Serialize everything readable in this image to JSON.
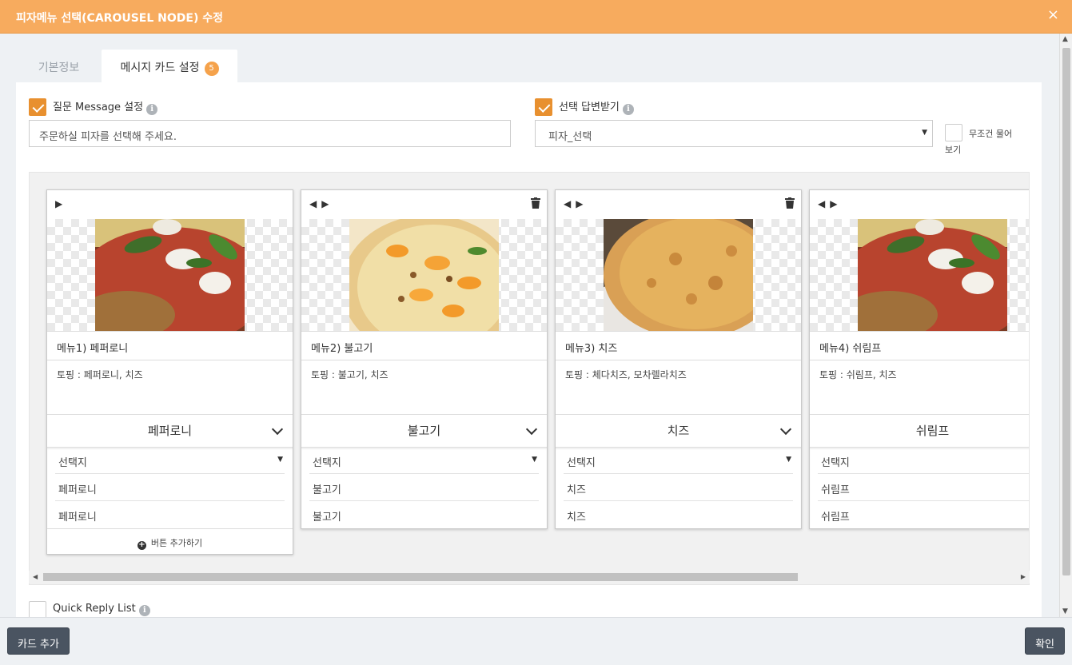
{
  "window": {
    "title": "피자메뉴 선택(CAROUSEL NODE) 수정",
    "close": "×"
  },
  "tabs": [
    {
      "label": "기본정보"
    },
    {
      "label": "메시지 카드 설정",
      "badge": "5"
    }
  ],
  "question": {
    "label": "질문 Message 설정",
    "checked": true,
    "value": "주문하실 피자를 선택해 주세요."
  },
  "answer": {
    "label": "선택 답변받기",
    "checked": true,
    "value": "피자_선택",
    "always_label": "무조건 물어보기"
  },
  "cards": [
    {
      "title": "메뉴1) 페퍼로니",
      "desc": "토핑 : 페퍼로니, 치즈",
      "button": "페퍼로니",
      "opt_select": "선택지",
      "opt1": "페퍼로니",
      "opt2": "페퍼로니"
    },
    {
      "title": "메뉴2) 불고기",
      "desc": "토핑 : 불고기, 치즈",
      "button": "불고기",
      "opt_select": "선택지",
      "opt1": "불고기",
      "opt2": "불고기"
    },
    {
      "title": "메뉴3) 치즈",
      "desc": "토핑 : 체다치즈, 모차렐라치즈",
      "button": "치즈",
      "opt_select": "선택지",
      "opt1": "치즈",
      "opt2": "치즈"
    },
    {
      "title": "메뉴4) 쉬림프",
      "desc": "토핑 : 쉬림프, 치즈",
      "button": "쉬림프",
      "opt_select": "선택지",
      "opt1": "쉬림프",
      "opt2": "쉬림프"
    }
  ],
  "add_button_label": "버튼 추가하기",
  "quick_reply": {
    "label": "Quick Reply List",
    "checked": false
  },
  "footer": {
    "add_card": "카드 추가",
    "confirm": "확인"
  },
  "colors": {
    "accent": "#f7ab5e",
    "check": "#e8902f",
    "dark_button": "#4a5461"
  }
}
